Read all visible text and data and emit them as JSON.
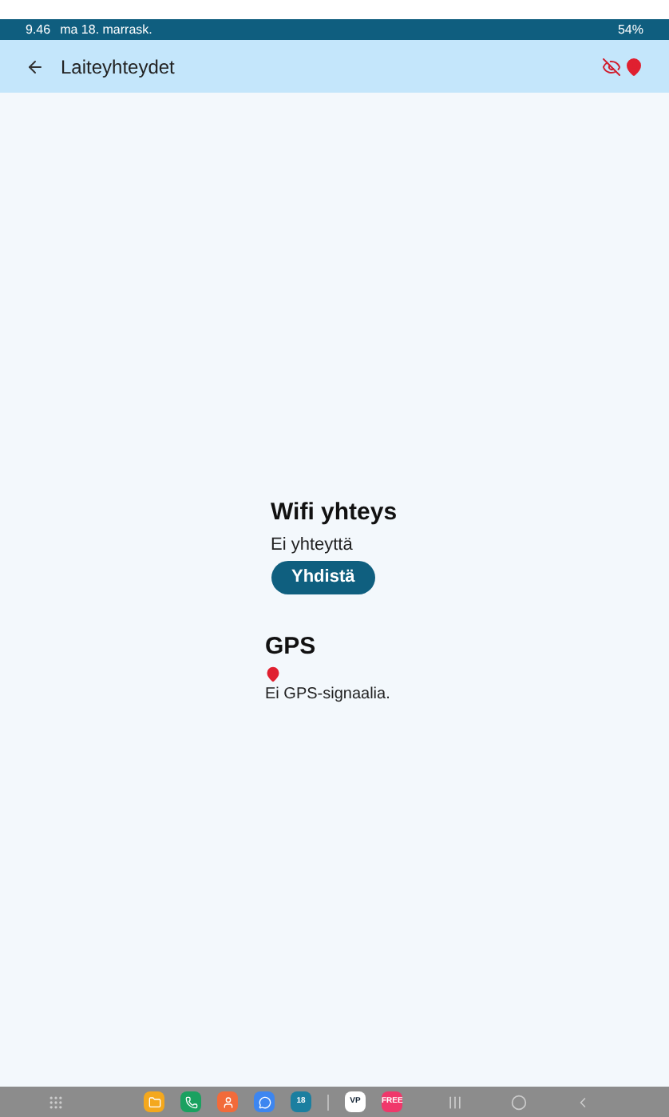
{
  "status_bar": {
    "time": "9.46",
    "date": "ma 18. marrask.",
    "battery": "54%"
  },
  "app_bar": {
    "title": "Laiteyhteydet"
  },
  "wifi": {
    "title": "Wifi yhteys",
    "status": "Ei yhteyttä",
    "button": "Yhdistä"
  },
  "gps": {
    "title": "GPS",
    "status": "Ei GPS-signaalia."
  },
  "taskbar": {
    "apps": [
      {
        "kind": "folder",
        "color": "#f4a81d"
      },
      {
        "kind": "phone",
        "color": "#1aa160"
      },
      {
        "kind": "contacts",
        "color": "#f26b3a"
      },
      {
        "kind": "messages",
        "color": "#3d86f0"
      },
      {
        "kind": "calendar",
        "color": "#1b7fa0",
        "label": "18"
      },
      {
        "kind": "divider"
      },
      {
        "kind": "app",
        "color": "#ffffff",
        "label": "VP"
      },
      {
        "kind": "app",
        "color": "#f0386b",
        "label": "FREE"
      }
    ]
  }
}
